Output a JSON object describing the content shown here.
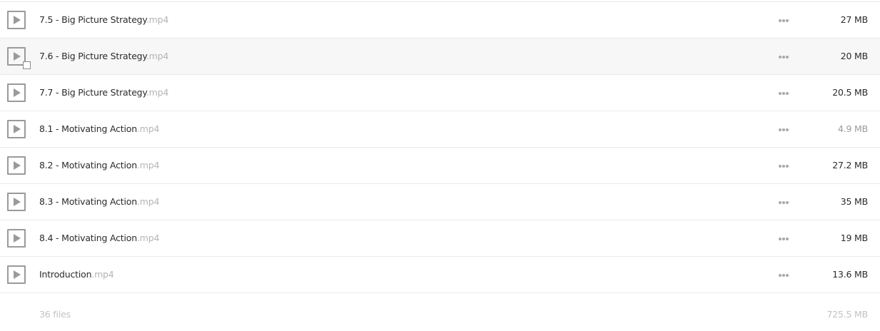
{
  "files": [
    {
      "name": "7.5 - Big Picture Strategy",
      "ext": ".mp4",
      "size": "27 MB"
    },
    {
      "name": "7.6 - Big Picture Strategy",
      "ext": ".mp4",
      "size": "20 MB"
    },
    {
      "name": "7.7 - Big Picture Strategy",
      "ext": ".mp4",
      "size": "20.5 MB"
    },
    {
      "name": "8.1 - Motivating Action",
      "ext": ".mp4",
      "size": "4.9 MB"
    },
    {
      "name": "8.2 - Motivating Action",
      "ext": ".mp4",
      "size": "27.2 MB"
    },
    {
      "name": "8.3 - Motivating Action",
      "ext": ".mp4",
      "size": "35 MB"
    },
    {
      "name": "8.4 - Motivating Action",
      "ext": ".mp4",
      "size": "19 MB"
    },
    {
      "name": "Introduction",
      "ext": ".mp4",
      "size": "13.6 MB"
    }
  ],
  "footer": {
    "file_count": "36 files",
    "total_size": "725.5 MB"
  },
  "icons": {
    "file": "video-file-icon",
    "more": "more-options-icon"
  },
  "colors": {
    "row_border": "#e9e9e9",
    "hover_background": "#f7f7f7",
    "extension_text": "#b4b4b4",
    "footer_text": "#c2c2c2"
  }
}
